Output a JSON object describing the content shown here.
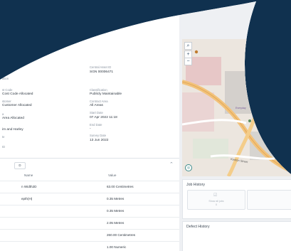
{
  "details": {
    "left_fields": [
      {
        "label": "ation",
        "value": ""
      },
      {
        "label": "st Code",
        "value": "Cost Code Allocated"
      },
      {
        "label": "stomer",
        "value": "Customer Allocated"
      },
      {
        "label": "a",
        "value": "Area Allocated"
      },
      {
        "label": "",
        "value": "im and Harley"
      },
      {
        "label": "te",
        "value": ""
      },
      {
        "label": "ID",
        "value": ""
      }
    ],
    "right_fields": [
      {
        "label": "Central Asset ID",
        "value": "SGN 00006471"
      },
      {
        "label": "Classification",
        "value": "Publicly Maintainable"
      },
      {
        "label": "Contract Area",
        "value": "All Areas"
      },
      {
        "label": "Start Date",
        "value": "07 Apr 2022 11:18"
      },
      {
        "label": "End Date",
        "value": "-"
      },
      {
        "label": "Survey Date",
        "value": "13 Jun 2022"
      }
    ]
  },
  "attributes": {
    "toggle_label": "D",
    "collapse_icon": "chevron-up-icon",
    "col_name": "Name",
    "col_value": "Value",
    "rows": [
      {
        "name": "n Width2D",
        "value": "63.00  Centimetres"
      },
      {
        "name": "epth(H)",
        "value": "0.35  Metres"
      },
      {
        "name": "",
        "value": "0.35  Metres"
      },
      {
        "name": "",
        "value": "2.05  Metres"
      },
      {
        "name": "",
        "value": "260.00  Centimetres"
      },
      {
        "name": "",
        "value": "1.00  Numeric"
      }
    ]
  },
  "map": {
    "search_icon": "search-icon",
    "zoom_in": "+",
    "zoom_out": "−",
    "street_label": "Kenton Street",
    "poi_label": "Everyday"
  },
  "job_history": {
    "title": "Job History",
    "empty_text": "Show all jobs",
    "empty_count": "0"
  },
  "defect_history": {
    "title": "Defect History"
  }
}
